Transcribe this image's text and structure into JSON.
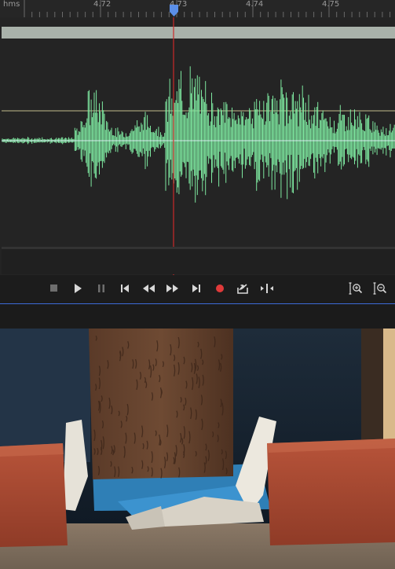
{
  "ruler": {
    "unit_label": "hms",
    "ticks": [
      "4.72",
      "4.73",
      "4.74",
      "4.75"
    ]
  },
  "playhead": {
    "time": "4.73"
  },
  "colors": {
    "waveform": "#7ee8a0",
    "playhead": "#cc2a2a",
    "playhead_handle": "#5b8fe8",
    "record": "#e03a3a",
    "accent_line": "#3d6bd8",
    "panel_bg": "#242424",
    "scrollbar": "#a9b2aa"
  },
  "transport": {
    "buttons": [
      {
        "name": "stop-button",
        "icon": "stop-icon",
        "label": "Stop"
      },
      {
        "name": "play-button",
        "icon": "play-icon",
        "label": "Play"
      },
      {
        "name": "pause-button",
        "icon": "pause-icon",
        "label": "Pause"
      },
      {
        "name": "skip-back-button",
        "icon": "skip-back-icon",
        "label": "Go to start"
      },
      {
        "name": "rewind-button",
        "icon": "rewind-icon",
        "label": "Rewind"
      },
      {
        "name": "fast-forward-button",
        "icon": "fast-forward-icon",
        "label": "Fast forward"
      },
      {
        "name": "skip-forward-button",
        "icon": "skip-forward-icon",
        "label": "Go to end"
      },
      {
        "name": "record-button",
        "icon": "record-icon",
        "label": "Record"
      },
      {
        "name": "export-button",
        "icon": "export-icon",
        "label": "Export"
      },
      {
        "name": "split-button",
        "icon": "split-icon",
        "label": "Split"
      },
      {
        "name": "zoom-in-button",
        "icon": "zoom-in-icon",
        "label": "Zoom in"
      },
      {
        "name": "zoom-out-button",
        "icon": "zoom-out-icon",
        "label": "Zoom out"
      }
    ]
  },
  "video_frame": {
    "content": "slow-motion video frame of a wooden board breaking a tile between two bricks"
  }
}
